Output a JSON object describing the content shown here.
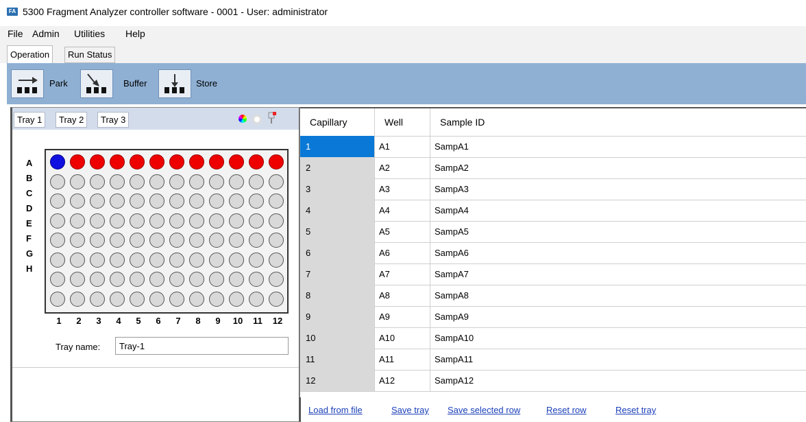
{
  "window": {
    "icon_text": "FA",
    "title": "5300 Fragment Analyzer controller software - 0001 - User: administrator"
  },
  "menu": [
    "File",
    "Admin",
    "Utilities",
    "Help"
  ],
  "tabs": [
    "Operation",
    "Run Status"
  ],
  "toolbar": {
    "park": "Park",
    "buffer": "Buffer",
    "store": "Store"
  },
  "trays": [
    "Tray 1",
    "Tray 2",
    "Tray 3"
  ],
  "plate": {
    "rows": [
      "A",
      "B",
      "C",
      "D",
      "E",
      "F",
      "G",
      "H"
    ],
    "cols": [
      "1",
      "2",
      "3",
      "4",
      "5",
      "6",
      "7",
      "8",
      "9",
      "10",
      "11",
      "12"
    ],
    "row_a_colors": [
      "blue",
      "red",
      "red",
      "red",
      "red",
      "red",
      "red",
      "red",
      "red",
      "red",
      "red",
      "red"
    ]
  },
  "tray_name": {
    "label": "Tray name:",
    "value": "Tray-1"
  },
  "table": {
    "headers": [
      "Capillary",
      "Well",
      "Sample ID"
    ],
    "rows": [
      [
        "1",
        "A1",
        "SampA1"
      ],
      [
        "2",
        "A2",
        "SampA2"
      ],
      [
        "3",
        "A3",
        "SampA3"
      ],
      [
        "4",
        "A4",
        "SampA4"
      ],
      [
        "5",
        "A5",
        "SampA5"
      ],
      [
        "6",
        "A6",
        "SampA6"
      ],
      [
        "7",
        "A7",
        "SampA7"
      ],
      [
        "8",
        "A8",
        "SampA8"
      ],
      [
        "9",
        "A9",
        "SampA9"
      ],
      [
        "10",
        "A10",
        "SampA10"
      ],
      [
        "11",
        "A11",
        "SampA11"
      ],
      [
        "12",
        "A12",
        "SampA12"
      ]
    ]
  },
  "actions": [
    "Load from file",
    "Save tray",
    "Save selected row",
    "Reset row",
    "Reset tray"
  ],
  "colors": {
    "toolbar": "#8fb0d3",
    "selected": "#0a78d6",
    "well_red": "#ee0000",
    "well_blue": "#1010e0",
    "link": "#1a3fb8"
  }
}
